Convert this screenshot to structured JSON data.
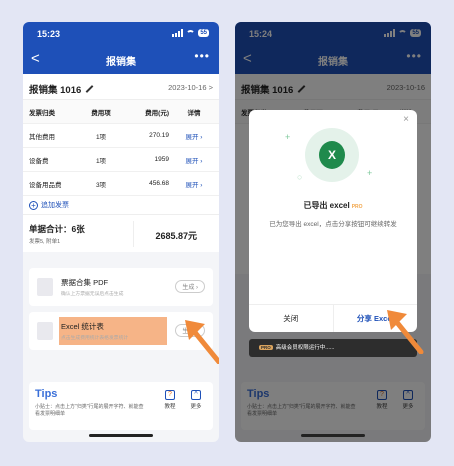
{
  "left": {
    "status": {
      "time": "15:23",
      "battery": "55"
    },
    "nav": {
      "back": "<",
      "title": "报销集",
      "more": "•••"
    },
    "header": {
      "title": "报销集 1016",
      "date": "2023-10-16",
      "chevron": ">"
    },
    "table": {
      "columns": [
        "发票归类",
        "费用项",
        "费用(元)",
        "详情"
      ],
      "rows": [
        {
          "category": "其他费用",
          "items": "1项",
          "amount": "270.19",
          "detail": "展开 ›"
        },
        {
          "category": "设备费",
          "items": "1项",
          "amount": "1959",
          "detail": "展开 ›"
        },
        {
          "category": "设备用品费",
          "items": "3项",
          "amount": "456.68",
          "detail": "展开 ›"
        }
      ]
    },
    "add_invoice": "追加发票",
    "summary": {
      "label": "单据合计：6张",
      "sub": "发票5, 附单1",
      "amount": "2685.87元"
    },
    "pdf_item": {
      "title": "票据合集 PDF",
      "subtitle": "确认上方票据无误后点击生成",
      "button": "生成 ›"
    },
    "excel_item": {
      "title": "Excel 统计表",
      "subtitle": "点击生成费用统计表格发票统计",
      "button": "生成 ›"
    },
    "tips": {
      "title": "Tips",
      "text": "小贴士：点击上方\"归类\"行尾的展开字符、就能查看发票明细单",
      "tutorial": "教程",
      "more": "更多"
    }
  },
  "right": {
    "status": {
      "time": "15:24",
      "battery": "55"
    },
    "nav": {
      "back": "<",
      "title": "报销集",
      "more": "•••"
    },
    "header": {
      "title": "报销集 1016",
      "date": "2023-10-16"
    },
    "table": {
      "columns": [
        "发票归类",
        "费用项",
        "费用(元)",
        "详情"
      ]
    },
    "modal": {
      "close": "×",
      "icon_text": "X",
      "title": "已导出 excel",
      "badge": "PRO",
      "message": "已为您导出 excel，点击分享按钮可继续转发",
      "cancel": "关闭",
      "confirm": "分享 Excel"
    },
    "toast": {
      "badge": "PRO",
      "text": "高级会员权限运行中......"
    },
    "tips": {
      "title": "Tips",
      "text": "小贴士：点击上方\"归类\"行尾的展开字符、就能查看发票明细单",
      "tutorial": "教程",
      "more": "更多"
    }
  },
  "colors": {
    "brand": "#1e50b8",
    "highlight": "#f6b487",
    "arrow": "#f08a3a",
    "excel": "#1f8a4c"
  }
}
